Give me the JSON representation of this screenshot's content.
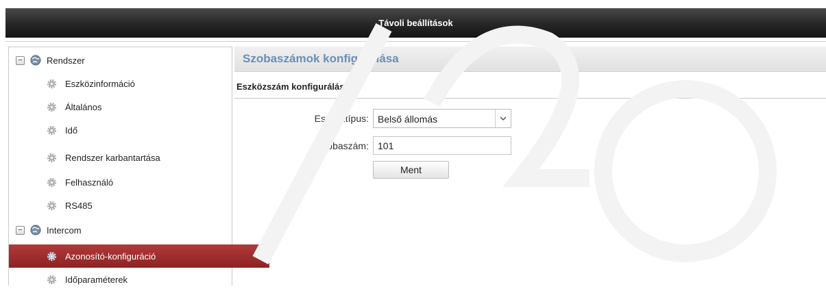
{
  "window": {
    "title": "Távoli beállítások"
  },
  "sidebar": {
    "groups": [
      {
        "label": "Rendszer",
        "expander": "−",
        "items": [
          {
            "label": "Eszközinformáció"
          },
          {
            "label": "Általános"
          },
          {
            "label": "Idő"
          },
          {
            "label": "Rendszer karbantartása"
          },
          {
            "label": "Felhasználó"
          },
          {
            "label": "RS485"
          }
        ]
      },
      {
        "label": "Intercom",
        "expander": "−",
        "items": [
          {
            "label": "Azonosító-konfiguráció",
            "selected": true
          },
          {
            "label": "Időparaméterek"
          }
        ]
      }
    ]
  },
  "main": {
    "title": "Szobaszámok konfigurálása",
    "section_title": "Eszközszám konfigurálása",
    "device_type": {
      "label": "Eszköztípus:",
      "value": "Belső állomás"
    },
    "room_number": {
      "label": "Szobaszám:",
      "value": "101"
    },
    "save_label": "Ment"
  },
  "colors": {
    "title_bar": "#262626",
    "selected_item": "#9b2d2d",
    "header_title": "#6a8fb8"
  },
  "icons": {
    "group": "globe-icon",
    "item": "gear-icon",
    "expander": "collapse-icon",
    "select": "chevron-down-icon"
  }
}
